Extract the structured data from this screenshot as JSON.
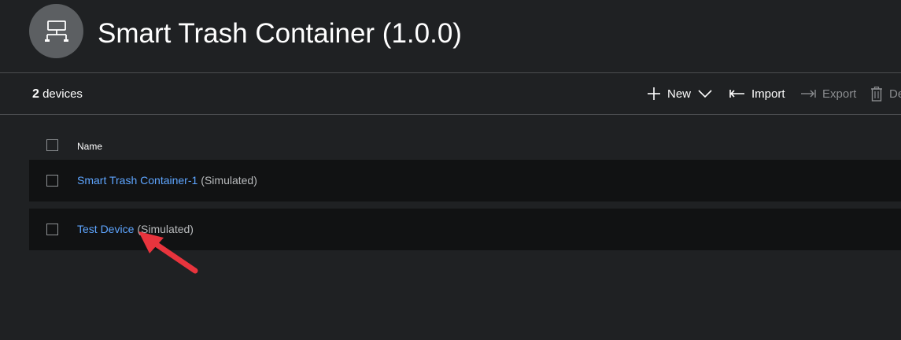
{
  "header": {
    "title": "Smart Trash Container (1.0.0)",
    "avatar_icon": "device-network-icon"
  },
  "toolbar": {
    "count_number": "2",
    "count_label": " devices",
    "new_label": "New",
    "import_label": "Import",
    "export_label": "Export",
    "delete_label": "De"
  },
  "list": {
    "column_name": "Name",
    "rows": [
      {
        "name": "Smart Trash Container-1",
        "suffix": "(Simulated)"
      },
      {
        "name": "Test Device",
        "suffix": "(Simulated)"
      }
    ]
  },
  "colors": {
    "background": "#1f2123",
    "row_background": "#111213",
    "link": "#5ea5ff",
    "annotation_arrow": "#e8343d"
  }
}
